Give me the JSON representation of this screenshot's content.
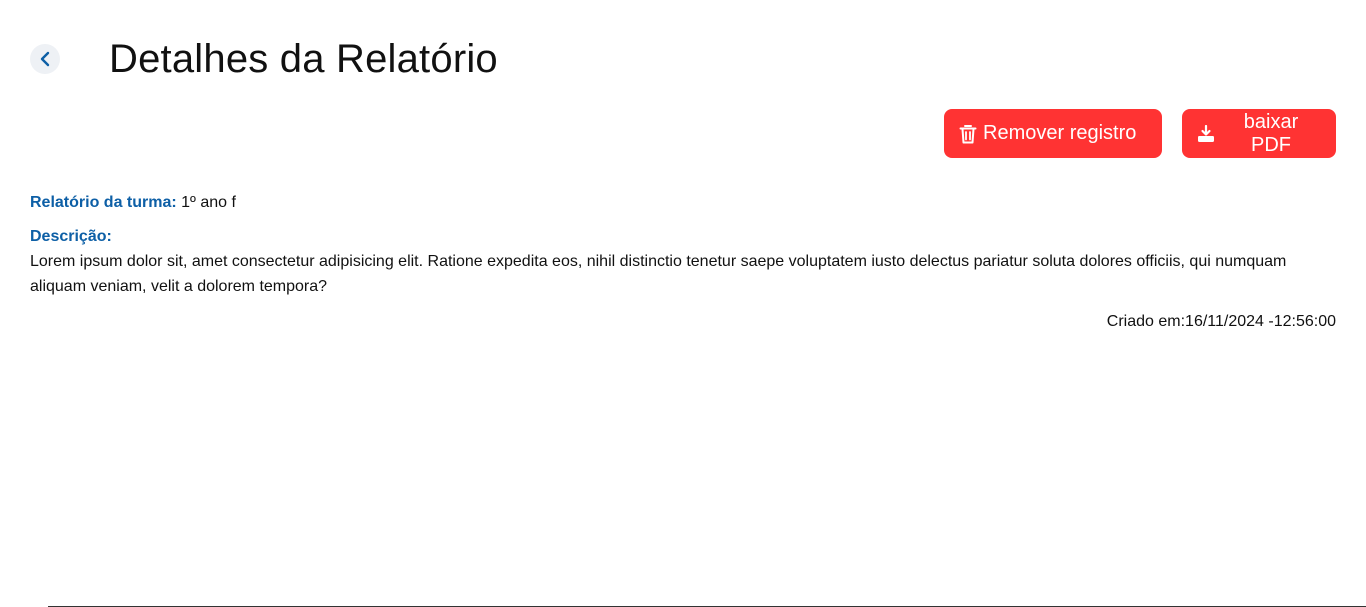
{
  "header": {
    "back_icon": "chevron-left-icon",
    "title": "Detalhes da Relatório"
  },
  "actions": {
    "remove": {
      "label": "Remover registro",
      "icon": "trash-icon"
    },
    "pdf": {
      "label": "baixar PDF",
      "icon": "download-icon"
    }
  },
  "report": {
    "turma_label": "Relatório da turma:",
    "turma_value": "1º ano f",
    "description_label": "Descrição:",
    "description_text": "Lorem ipsum dolor sit, amet consectetur adipisicing elit. Ratione expedita eos, nihil distinctio tenetur saepe voluptatem iusto delectus pariatur soluta dolores officiis, qui numquam aliquam veniam, velit a dolorem tempora?",
    "created_label": "Criado em:",
    "created_value": "16/11/2024 -12:56:00"
  },
  "colors": {
    "accent_blue": "#0d5fa6",
    "danger_red": "#ff3333"
  }
}
